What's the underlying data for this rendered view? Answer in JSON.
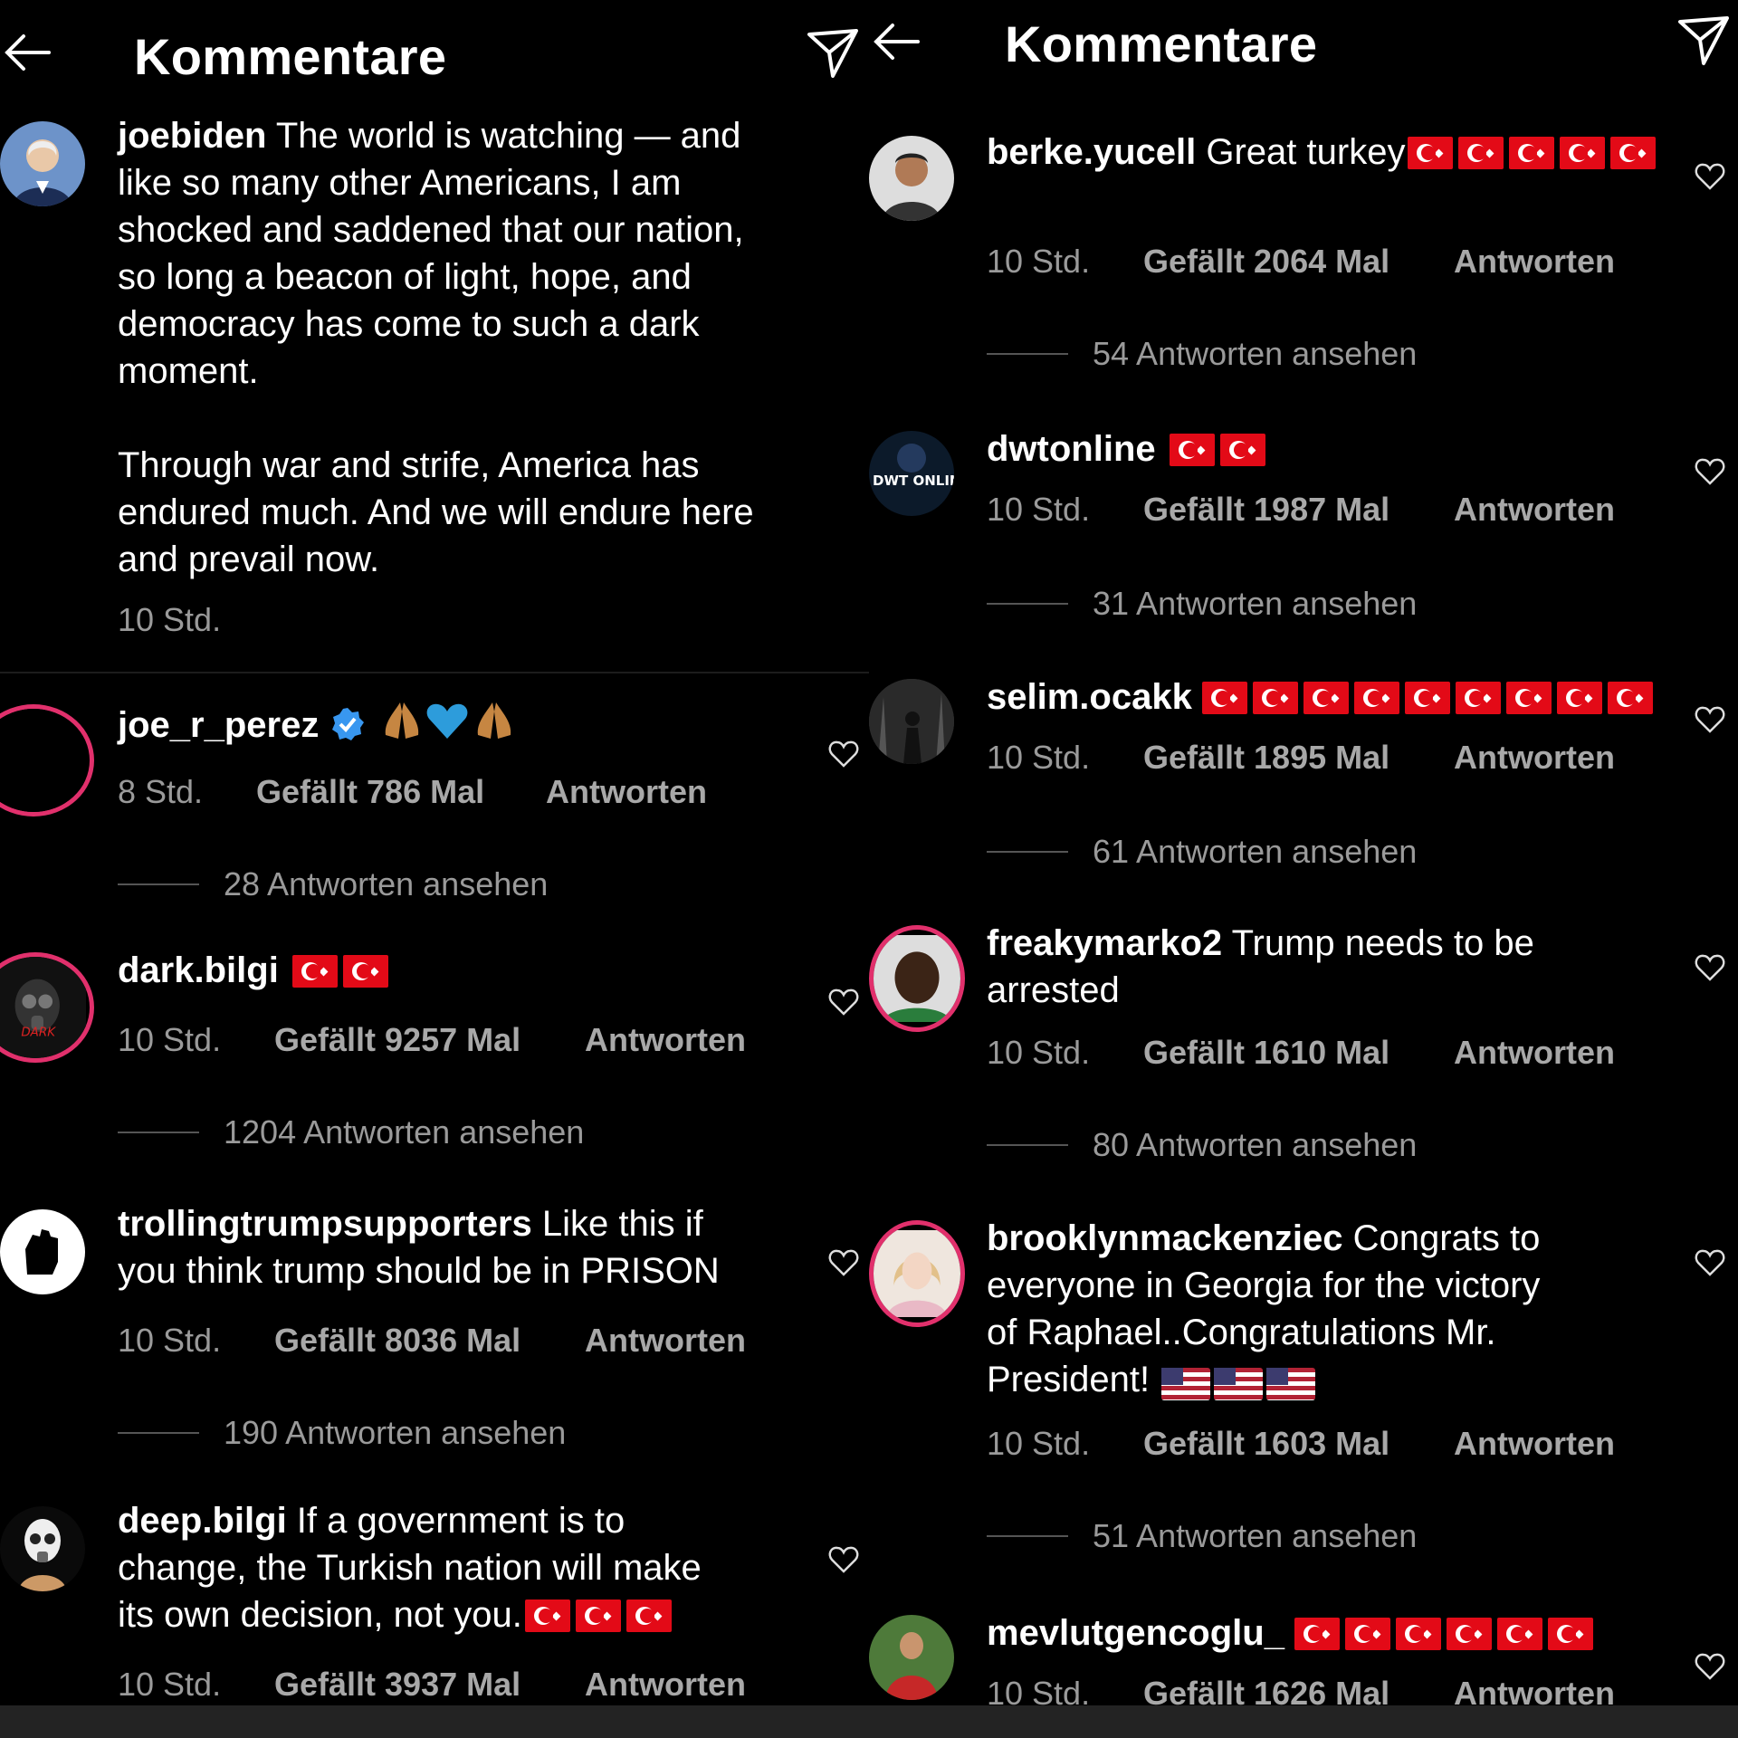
{
  "left": {
    "title": "Kommentare",
    "caption": {
      "username": "joebiden",
      "text": " The world is watching — and\nlike so many other Americans, I am\nshocked and saddened that our nation,\nso long a beacon of light, hope, and\ndemocracy has come to such a dark\nmoment.\n\nThrough war and strife, America has\nendured much. And we will endure here\nand prevail now.",
      "time": "10 Std."
    },
    "comments": [
      {
        "username": "joe_r_perez",
        "text": "",
        "time": "8 Std.",
        "likes": "Gefällt 786 Mal",
        "reply": "Antworten",
        "replies": "28 Antworten ansehen"
      },
      {
        "username": "dark.bilgi",
        "text": "",
        "time": "10 Std.",
        "likes": "Gefällt 9257 Mal",
        "reply": "Antworten",
        "replies": "1204 Antworten ansehen"
      },
      {
        "username": "trollingtrumpsupporters",
        "text": " Like this if\nyou think trump should be in PRISON",
        "time": "10 Std.",
        "likes": "Gefällt 8036 Mal",
        "reply": "Antworten",
        "replies": "190 Antworten ansehen"
      },
      {
        "username": "deep.bilgi",
        "text": " If a government is to\nchange, the Turkish nation will make\nits own decision, not you.",
        "time": "10 Std.",
        "likes": "Gefällt 3937 Mal",
        "reply": "Antworten"
      }
    ]
  },
  "right": {
    "title": "Kommentare",
    "comments": [
      {
        "username": "berke.yucell",
        "text": " Great turkey",
        "time": "10 Std.",
        "likes": "Gefällt 2064 Mal",
        "reply": "Antworten",
        "replies": "54 Antworten ansehen"
      },
      {
        "username": "dwtonline",
        "text": "",
        "time": "10 Std.",
        "likes": "Gefällt 1987 Mal",
        "reply": "Antworten",
        "replies": "31 Antworten ansehen",
        "avatar_text": "DWT ONLINE"
      },
      {
        "username": "selim.ocakk",
        "text": "",
        "time": "10 Std.",
        "likes": "Gefällt 1895 Mal",
        "reply": "Antworten",
        "replies": "61 Antworten ansehen"
      },
      {
        "username": "freakymarko2",
        "text": " Trump needs to be\narrested",
        "time": "10 Std.",
        "likes": "Gefällt 1610 Mal",
        "reply": "Antworten",
        "replies": "80 Antworten ansehen"
      },
      {
        "username": "brooklynmackenziec",
        "text": " Congrats to\neveryone in Georgia for the victory\nof Raphael..Congratulations Mr.\nPresident! ",
        "time": "10 Std.",
        "likes": "Gefällt 1603 Mal",
        "reply": "Antworten",
        "replies": "51 Antworten ansehen"
      },
      {
        "username": "mevlutgencoglu_",
        "text": "",
        "time": "10 Std.",
        "likes": "Gefällt 1626 Mal",
        "reply": "Antworten"
      }
    ]
  },
  "icons": {
    "back": "arrow-left-icon",
    "send": "paper-plane-icon",
    "like": "heart-outline-icon",
    "verified": "verified-badge-icon"
  },
  "colors": {
    "background": "#000000",
    "meta_text": "#9a9a9a",
    "verified": "#3897f0",
    "story_ring": "#e1306c"
  }
}
